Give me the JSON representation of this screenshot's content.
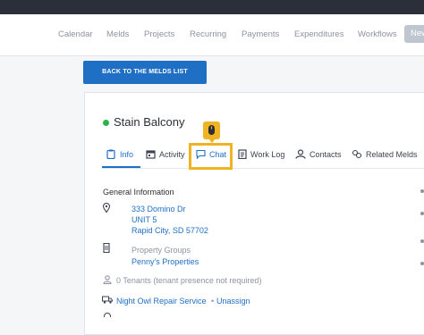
{
  "nav": {
    "items": [
      "Calendar",
      "Melds",
      "Projects",
      "Recurring",
      "Payments",
      "Expenditures",
      "Workflows"
    ],
    "new_label": "New"
  },
  "back_button": "BACK TO THE MELDS LIST",
  "meld": {
    "title": "Stain Balcony",
    "status_color": "#2bb24c"
  },
  "tabs": [
    "Info",
    "Activity",
    "Chat",
    "Work Log",
    "Contacts",
    "Related Melds"
  ],
  "active_tab": "Info",
  "general_info": {
    "heading": "General Information",
    "address_line1": "333 Domino Dr",
    "address_line2": "UNIT 5",
    "address_line3": "Rapid City, SD 57702",
    "property_groups_label": "Property Groups",
    "property_group": "Penny's Properties",
    "tenants": "0 Tenants (tenant presence not required)",
    "vendor": "Night Owl Repair Service",
    "separator": "•",
    "unassign": "Unassign"
  },
  "colors": {
    "accent": "#1f6fc4",
    "highlight": "#f0b323"
  }
}
